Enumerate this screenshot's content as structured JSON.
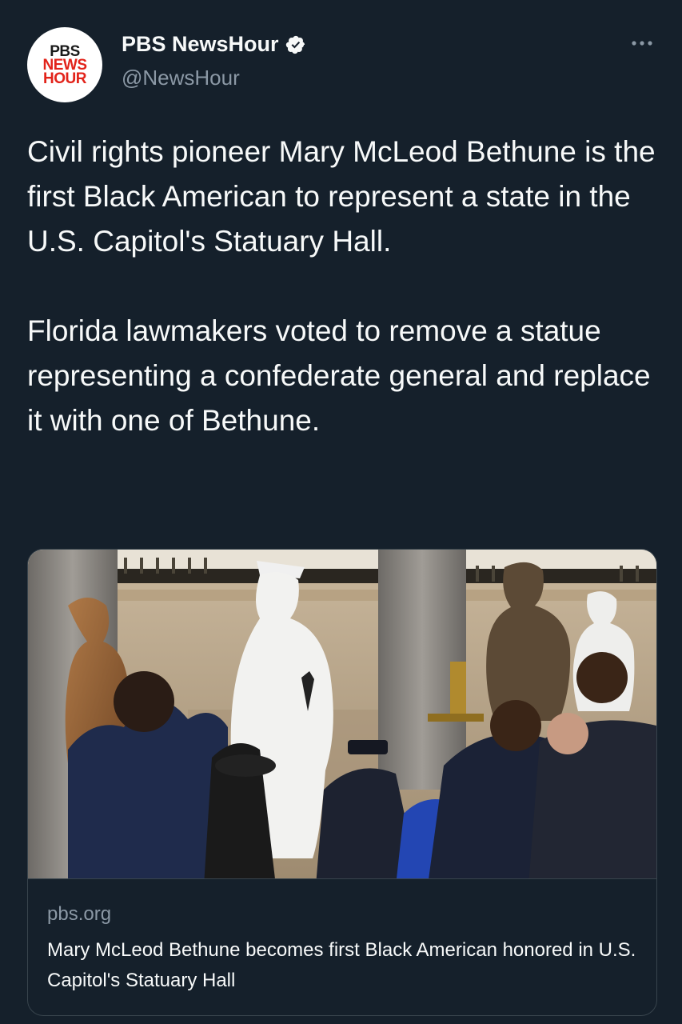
{
  "account": {
    "name": "PBS NewsHour",
    "handle": "@NewsHour",
    "verified": true,
    "avatar_logo_lines": [
      "PBS",
      "NEWS",
      "HOUR"
    ]
  },
  "tweet": {
    "paragraphs": [
      "Civil rights pioneer Mary McLeod Bethune is the first Black American to represent a state in the U.S. Capitol's Statuary Hall.",
      "Florida lawmakers voted to remove a statue representing a confederate general and replace it with one of Bethune."
    ]
  },
  "link_card": {
    "domain": "pbs.org",
    "title": "Mary McLeod Bethune becomes first Black American honored in U.S. Capitol's Statuary Hall",
    "image_description_icon": "photo-statuary-hall"
  },
  "icons": {
    "verified": "verified-badge-icon",
    "more": "more-options-icon"
  },
  "colors": {
    "background": "#15202b",
    "text_primary": "#f7f9f9",
    "text_secondary": "#8b98a5",
    "border": "#38444d",
    "brand_red": "#e2231a"
  }
}
